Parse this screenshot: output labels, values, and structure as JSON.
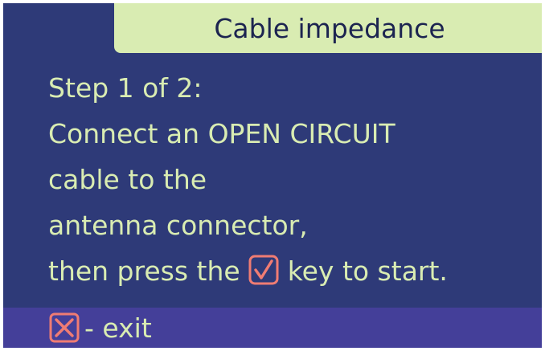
{
  "header": {
    "title": "Cable impedance"
  },
  "instructions": {
    "step": "Step 1 of 2:",
    "line1": "Connect an OPEN CIRCUIT",
    "line2": "cable to the",
    "line3": "antenna connector,",
    "line4_before_icon": "then press the",
    "line4_after_icon": "key to start."
  },
  "footer": {
    "exit_label": "- exit"
  },
  "icons": {
    "confirm_key": "check-key-icon",
    "exit_key": "cross-key-icon"
  },
  "colors": {
    "background": "#2e3a78",
    "footer_background": "#443f99",
    "title_background": "#d9ecb2",
    "text": "#d9ecb2",
    "key_icon": "#f07c73"
  }
}
